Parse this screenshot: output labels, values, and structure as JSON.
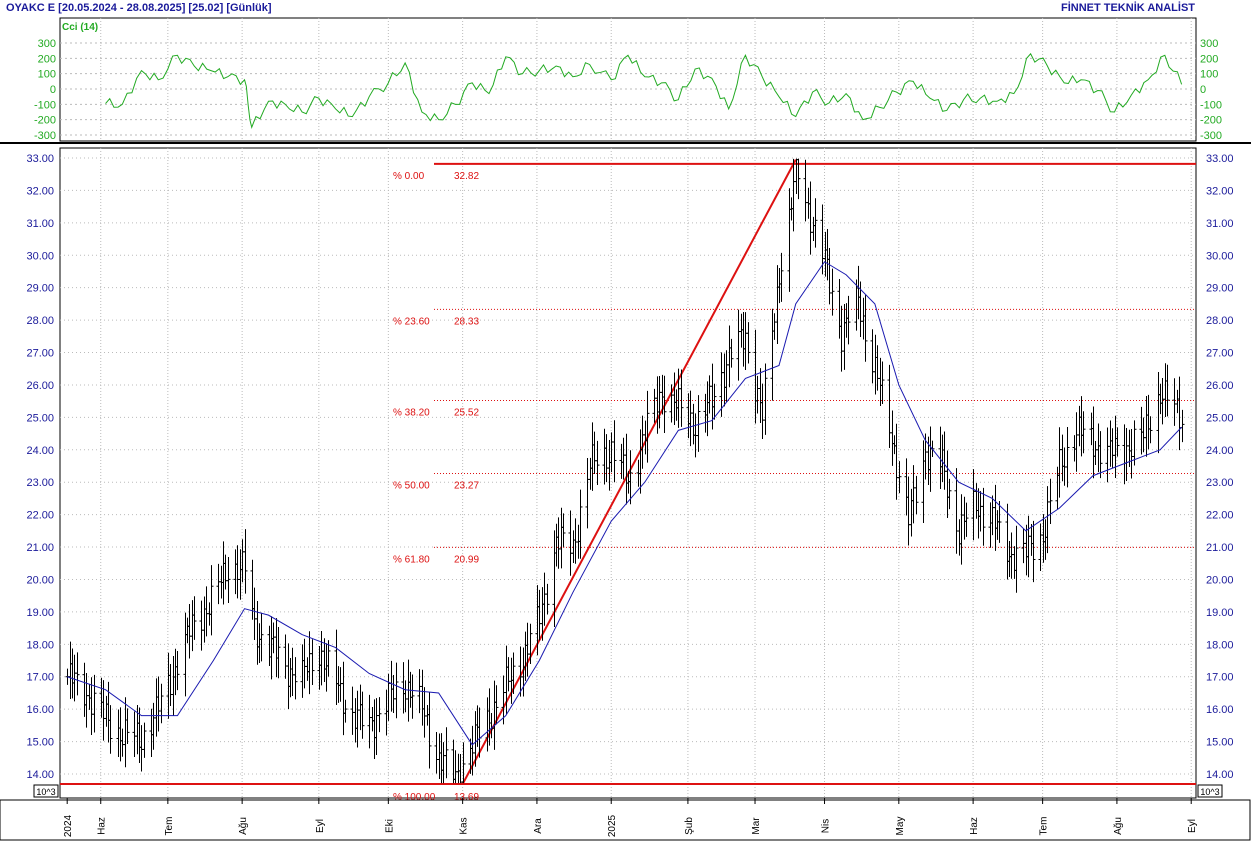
{
  "header": {
    "symbol_info": "OYAKC E  [20.05.2024 - 28.08.2025]  [25.02]  [Günlük]",
    "brand": "FİNNET TEKNİK ANALİST"
  },
  "colors": {
    "price_bars": "#000000",
    "moving_average": "#1a1ab0",
    "cci_line": "#22aa22",
    "fibonacci": "#dd1111",
    "axis_text": "#1a1a9a",
    "grid": "#bbbbbb"
  },
  "chart_data": [
    {
      "type": "line",
      "title": "Cci (14)",
      "ylim": [
        -300,
        300
      ],
      "yticks": [
        300,
        200,
        100,
        0,
        -100,
        -200,
        -300
      ],
      "grid": true,
      "x": [
        "2024-06-05",
        "2024-06-12",
        "2024-06-20",
        "2024-06-27",
        "2024-07-05",
        "2024-07-12",
        "2024-07-19",
        "2024-07-26",
        "2024-08-02",
        "2024-08-05",
        "2024-08-12",
        "2024-08-19",
        "2024-08-26",
        "2024-09-02",
        "2024-09-09",
        "2024-09-16",
        "2024-09-23",
        "2024-10-01",
        "2024-10-08",
        "2024-10-15",
        "2024-10-22",
        "2024-10-29",
        "2024-11-05",
        "2024-11-12",
        "2024-11-19",
        "2024-11-26",
        "2024-12-03",
        "2024-12-10",
        "2024-12-17",
        "2024-12-24",
        "2025-01-02",
        "2025-01-09",
        "2025-01-16",
        "2025-01-23",
        "2025-01-30",
        "2025-02-06",
        "2025-02-13",
        "2025-02-20",
        "2025-02-27",
        "2025-03-06",
        "2025-03-13",
        "2025-03-20",
        "2025-03-27",
        "2025-04-03",
        "2025-04-10",
        "2025-04-17",
        "2025-04-24",
        "2025-05-01",
        "2025-05-08",
        "2025-05-15",
        "2025-05-22",
        "2025-05-29",
        "2025-06-05",
        "2025-06-12",
        "2025-06-19",
        "2025-06-26",
        "2025-07-03",
        "2025-07-10",
        "2025-07-17",
        "2025-07-24",
        "2025-07-31",
        "2025-08-07",
        "2025-08-14",
        "2025-08-21",
        "2025-08-28"
      ],
      "values": [
        -95,
        -100,
        120,
        60,
        220,
        150,
        120,
        80,
        60,
        -250,
        -80,
        -100,
        -150,
        -60,
        -130,
        -180,
        -50,
        40,
        170,
        -150,
        -200,
        -100,
        40,
        -30,
        210,
        100,
        120,
        150,
        80,
        160,
        60,
        220,
        80,
        40,
        -70,
        130,
        70,
        -130,
        220,
        80,
        -50,
        -180,
        -20,
        -90,
        -30,
        -200,
        -120,
        -20,
        50,
        -60,
        -140,
        -70,
        -60,
        -80,
        -30,
        230,
        150,
        40,
        60,
        -10,
        -150,
        -40,
        60,
        220,
        30
      ]
    },
    {
      "type": "bar",
      "title": "",
      "ylim": [
        13.6,
        33.0
      ],
      "yticks": [
        "33.00",
        "32.00",
        "31.00",
        "30.00",
        "29.00",
        "28.00",
        "27.00",
        "26.00",
        "25.00",
        "24.00",
        "23.00",
        "22.00",
        "21.00",
        "20.00",
        "19.00",
        "18.00",
        "17.00",
        "16.00",
        "15.00",
        "14.00"
      ],
      "x_labels": [
        {
          "date": "2024-05-20",
          "label": "2024"
        },
        {
          "date": "2024-06-03",
          "label": "Haz"
        },
        {
          "date": "2024-07-01",
          "label": "Tem"
        },
        {
          "date": "2024-08-01",
          "label": "Ağu"
        },
        {
          "date": "2024-09-02",
          "label": "Eyl"
        },
        {
          "date": "2024-10-01",
          "label": "Eki"
        },
        {
          "date": "2024-11-01",
          "label": "Kas"
        },
        {
          "date": "2024-12-02",
          "label": "Ara"
        },
        {
          "date": "2025-01-02",
          "label": "2025"
        },
        {
          "date": "2025-02-03",
          "label": "Şub"
        },
        {
          "date": "2025-03-03",
          "label": "Mar"
        },
        {
          "date": "2025-04-01",
          "label": "Nis"
        },
        {
          "date": "2025-05-02",
          "label": "May"
        },
        {
          "date": "2025-06-02",
          "label": "Haz"
        },
        {
          "date": "2025-07-01",
          "label": "Tem"
        },
        {
          "date": "2025-08-01",
          "label": "Ağu"
        },
        {
          "date": "2025-09-01",
          "label": "Eyl"
        }
      ],
      "scale_note": "10^3",
      "grid": true,
      "price_anchors": {
        "x": [
          "2024-05-20",
          "2024-05-27",
          "2024-06-04",
          "2024-06-12",
          "2024-06-20",
          "2024-06-27",
          "2024-07-05",
          "2024-07-12",
          "2024-07-19",
          "2024-07-26",
          "2024-08-02",
          "2024-08-06",
          "2024-08-12",
          "2024-08-19",
          "2024-08-26",
          "2024-09-02",
          "2024-09-09",
          "2024-09-16",
          "2024-09-23",
          "2024-10-01",
          "2024-10-08",
          "2024-10-15",
          "2024-10-22",
          "2024-10-29",
          "2024-11-05",
          "2024-11-12",
          "2024-11-19",
          "2024-11-26",
          "2024-12-03",
          "2024-12-10",
          "2024-12-17",
          "2024-12-24",
          "2025-01-02",
          "2025-01-09",
          "2025-01-16",
          "2025-01-23",
          "2025-01-30",
          "2025-02-06",
          "2025-02-13",
          "2025-02-20",
          "2025-02-27",
          "2025-03-06",
          "2025-03-13",
          "2025-03-18",
          "2025-03-20",
          "2025-03-25",
          "2025-04-01",
          "2025-04-08",
          "2025-04-15",
          "2025-04-22",
          "2025-04-29",
          "2025-05-06",
          "2025-05-13",
          "2025-05-20",
          "2025-05-27",
          "2025-06-03",
          "2025-06-10",
          "2025-06-17",
          "2025-06-24",
          "2025-07-01",
          "2025-07-08",
          "2025-07-15",
          "2025-07-22",
          "2025-07-29",
          "2025-08-05",
          "2025-08-12",
          "2025-08-19",
          "2025-08-28"
        ],
        "close": [
          17.0,
          16.6,
          15.8,
          15.2,
          15.1,
          16.0,
          17.5,
          18.7,
          19.3,
          20.4,
          20.3,
          18.5,
          18.0,
          17.3,
          17.0,
          17.8,
          16.8,
          15.8,
          15.5,
          16.3,
          16.8,
          16.0,
          14.5,
          13.9,
          14.9,
          15.8,
          16.7,
          17.6,
          18.8,
          21.2,
          21.0,
          23.5,
          24.0,
          23.0,
          24.5,
          25.8,
          25.3,
          24.8,
          25.5,
          26.9,
          27.5,
          25.0,
          29.5,
          31.5,
          32.8,
          31.5,
          29.8,
          27.6,
          28.6,
          26.5,
          24.4,
          21.8,
          24.0,
          23.5,
          21.5,
          22.3,
          21.8,
          20.8,
          20.8,
          21.4,
          23.5,
          24.6,
          24.2,
          23.9,
          24.1,
          24.4,
          25.8,
          25.0
        ]
      },
      "series": [
        {
          "name": "",
          "kind": "moving-average",
          "x": [
            "2024-05-20",
            "2024-06-05",
            "2024-06-20",
            "2024-07-05",
            "2024-07-20",
            "2024-08-02",
            "2024-08-12",
            "2024-08-26",
            "2024-09-09",
            "2024-09-23",
            "2024-10-08",
            "2024-10-22",
            "2024-11-05",
            "2024-11-19",
            "2024-12-03",
            "2024-12-17",
            "2025-01-02",
            "2025-01-16",
            "2025-01-30",
            "2025-02-13",
            "2025-02-27",
            "2025-03-13",
            "2025-03-20",
            "2025-04-01",
            "2025-04-10",
            "2025-04-22",
            "2025-05-02",
            "2025-05-13",
            "2025-05-27",
            "2025-06-10",
            "2025-06-24",
            "2025-07-08",
            "2025-07-22",
            "2025-08-05",
            "2025-08-19",
            "2025-08-28"
          ],
          "values": [
            17.0,
            16.6,
            15.8,
            15.8,
            17.5,
            19.1,
            18.9,
            18.3,
            17.9,
            17.1,
            16.6,
            16.5,
            14.9,
            15.8,
            17.5,
            19.6,
            21.8,
            23.0,
            24.6,
            24.9,
            26.2,
            26.6,
            28.5,
            29.8,
            29.4,
            28.5,
            26.0,
            24.3,
            23.0,
            22.5,
            21.5,
            22.2,
            23.2,
            23.6,
            24.0,
            24.7
          ]
        }
      ],
      "fibonacci": {
        "levels": [
          {
            "pct": "% 0.00",
            "value": "32.82"
          },
          {
            "pct": "% 23.60",
            "value": "28.33"
          },
          {
            "pct": "% 38.20",
            "value": "25.52"
          },
          {
            "pct": "% 50.00",
            "value": "23.27"
          },
          {
            "pct": "% 61.80",
            "value": "20.99"
          },
          {
            "pct": "% 100.00",
            "value": "13.69"
          }
        ],
        "trend_start": {
          "date": "2024-11-01",
          "price": 13.69
        },
        "trend_end": {
          "date": "2025-03-20",
          "price": 32.95
        }
      }
    }
  ]
}
